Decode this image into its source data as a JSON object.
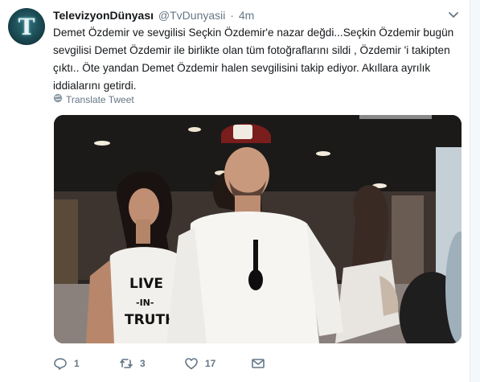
{
  "tweet": {
    "display_name": "TelevizyonDünyası",
    "handle": "@TvDunyasii",
    "separator": "·",
    "time": "4m",
    "text": "Demet Özdemir ve sevgilisi Seçkin Özdemir'e nazar değdi...Seçkin Özdemir bugün sevgilisi Demet Özdemir ile birlikte olan tüm fotoğraflarını sildi , Özdemir 'i takipten çıktı.. Öte yandan Demet Özdemir halen sevgilisini takip ediyor. Akıllara ayrılık iddialarını getirdi.",
    "translate_label": "Translate Tweet",
    "avatar_letter": "T",
    "photo": {
      "tshirt_line1": "LIVE",
      "tshirt_line2": "-IN-",
      "tshirt_line3": "TRUTH"
    },
    "actions": {
      "reply_count": "1",
      "retweet_count": "3",
      "like_count": "17"
    }
  },
  "colors": {
    "text": "#14171a",
    "muted": "#657786",
    "border": "#e6ecf0"
  },
  "icons": [
    "chevron-down-icon",
    "globe-icon",
    "reply-icon",
    "retweet-icon",
    "like-icon",
    "direct-message-icon"
  ]
}
